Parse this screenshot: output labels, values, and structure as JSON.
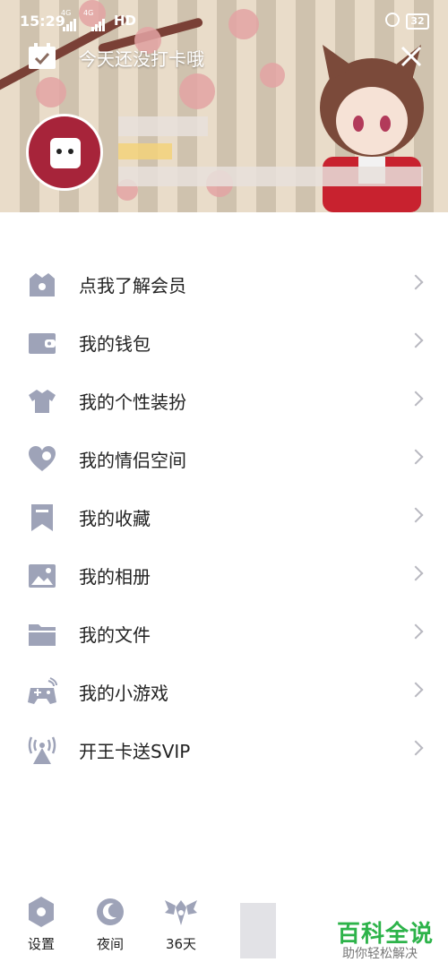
{
  "status_bar": {
    "time": "15:29",
    "network_1": "4G",
    "network_2": "4G",
    "hd": "HD",
    "battery": "32"
  },
  "checkin": {
    "text": "今天还没打卡哦"
  },
  "menu": {
    "items": [
      {
        "label": "点我了解会员",
        "icon": "vip-crown-icon"
      },
      {
        "label": "我的钱包",
        "icon": "wallet-icon"
      },
      {
        "label": "我的个性装扮",
        "icon": "shirt-icon"
      },
      {
        "label": "我的情侣空间",
        "icon": "heart-icon"
      },
      {
        "label": "我的收藏",
        "icon": "bookmark-icon"
      },
      {
        "label": "我的相册",
        "icon": "photo-icon"
      },
      {
        "label": "我的文件",
        "icon": "folder-icon"
      },
      {
        "label": "我的小游戏",
        "icon": "gamepad-icon"
      },
      {
        "label": "开王卡送SVIP",
        "icon": "signal-tower-icon"
      }
    ]
  },
  "bottom_bar": {
    "settings": "设置",
    "night": "夜间",
    "days": "36天"
  },
  "watermark": {
    "title": "百科全说",
    "subtitle": "助你轻松解决"
  },
  "colors": {
    "icon": "#9ea3b8",
    "accent_green": "#2db34a"
  }
}
